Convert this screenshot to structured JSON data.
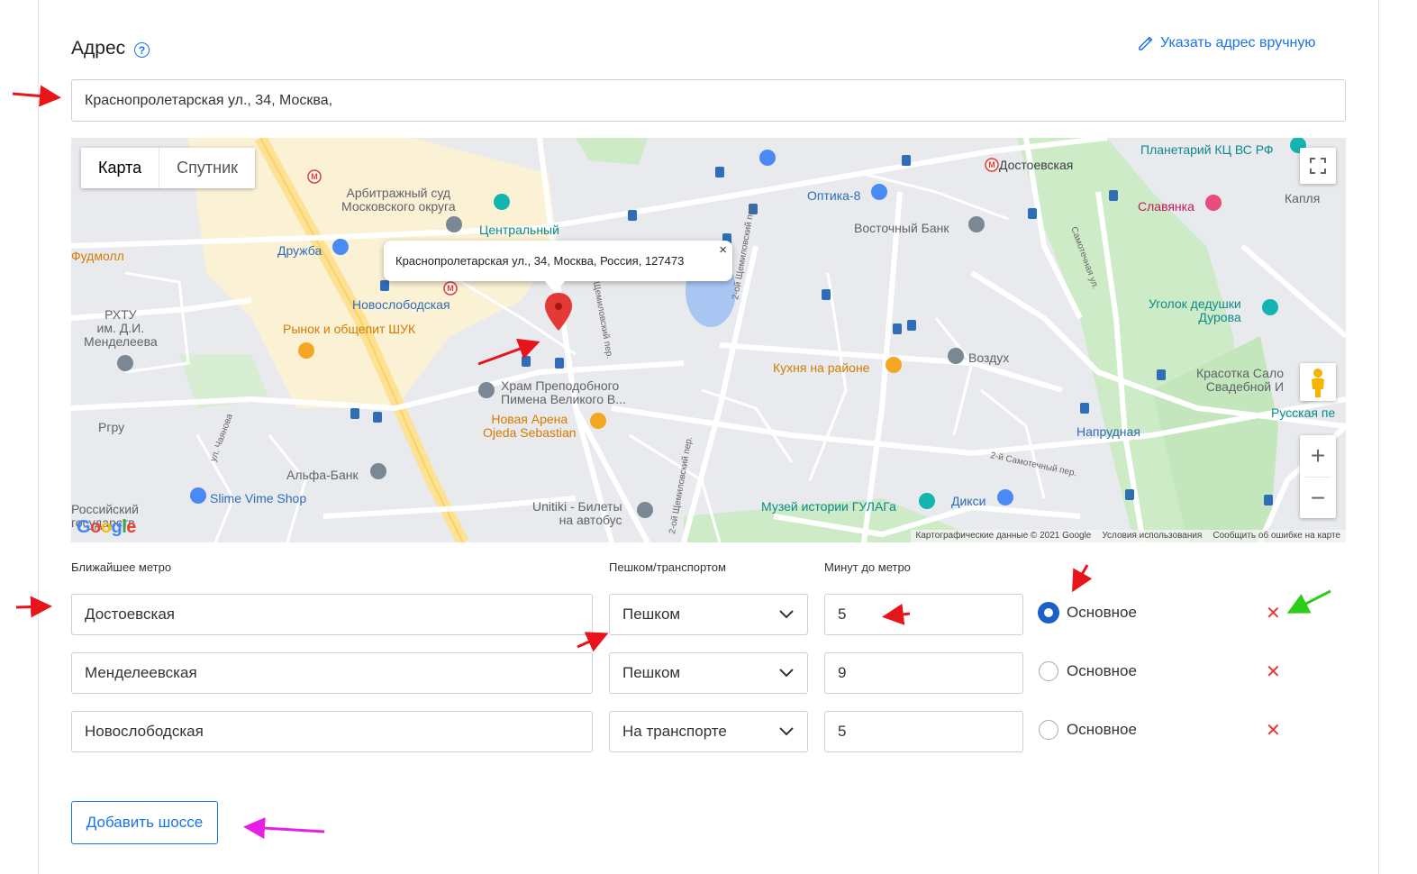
{
  "address": {
    "title": "Адрес",
    "help_icon": "?",
    "manual_link": "Указать адрес вручную",
    "value": "Краснопролетарская ул., 34, Москва,"
  },
  "map": {
    "tabs": [
      "Карта",
      "Спутник"
    ],
    "popup_text": "Краснопролетарская ул., 34, Москва, Россия, 127473",
    "popup_close": "×",
    "zoom_in": "+",
    "zoom_out": "−",
    "attribution": [
      "Картографические данные © 2021 Google",
      "Условия использования",
      "Сообщить об ошибке на карте"
    ],
    "logo": "Google",
    "labels": [
      {
        "text": "Достоевская",
        "style": "dark"
      },
      {
        "text": "Планетарий КЦ ВС РФ",
        "style": "teal"
      },
      {
        "text": "Арбитражный суд\nМосковского округа",
        "style": "gray"
      },
      {
        "text": "Оптика-8",
        "style": "blue"
      },
      {
        "text": "Славянка",
        "style": "pink"
      },
      {
        "text": "Капля",
        "style": "gray"
      },
      {
        "text": "Центральный",
        "style": "teal"
      },
      {
        "text": "Восточный Банк",
        "style": "gray"
      },
      {
        "text": "Фудмолл",
        "style": "orange"
      },
      {
        "text": "Дружба",
        "style": "blue"
      },
      {
        "text": "Новослободская",
        "style": "blue"
      },
      {
        "text": "Уголок дедушки\nДурова",
        "style": "teal"
      },
      {
        "text": "РХТУ\nим. Д.И.\nМенделеева",
        "style": "gray"
      },
      {
        "text": "Рынок и общепит ШУК",
        "style": "orange"
      },
      {
        "text": "Кухня на районе",
        "style": "orange"
      },
      {
        "text": "Воздух",
        "style": "gray"
      },
      {
        "text": "Красотка Сало\nСвадебной И",
        "style": "gray"
      },
      {
        "text": "Храм Преподобного\nПимена Великого В...",
        "style": "gray"
      },
      {
        "text": "Новая Арена\nOjeda Sebastian",
        "style": "orange"
      },
      {
        "text": "Русская пе",
        "style": "teal"
      },
      {
        "text": "Напрудная",
        "style": "blue"
      },
      {
        "text": "Ргру",
        "style": "gray"
      },
      {
        "text": "Альфа-Банк",
        "style": "gray"
      },
      {
        "text": "Slime Vime Shop",
        "style": "blue"
      },
      {
        "text": "Музей истории ГУЛАГа",
        "style": "teal"
      },
      {
        "text": "Дикси",
        "style": "blue"
      },
      {
        "text": "Unitiki - Билеты\nна автобус",
        "style": "gray"
      },
      {
        "text": "Российский\nгосударств",
        "style": "gray"
      }
    ]
  },
  "metro": {
    "headers": {
      "station": "Ближайшее метро",
      "mode": "Пешком/транспортом",
      "minutes": "Минут до метро"
    },
    "rows": [
      {
        "station": "Достоевская",
        "mode": "Пешком",
        "minutes": "5",
        "primary_label": "Основное",
        "primary": true,
        "delete": "✕"
      },
      {
        "station": "Менделеевская",
        "mode": "Пешком",
        "minutes": "9",
        "primary_label": "Основное",
        "primary": false,
        "delete": "✕"
      },
      {
        "station": "Новослободская",
        "mode": "На транспорте",
        "minutes": "5",
        "primary_label": "Основное",
        "primary": false,
        "delete": "✕"
      }
    ]
  },
  "add_highway": "Добавить шоссе",
  "colors": {
    "accent": "#1a73e8",
    "delete": "#e53935",
    "radio_checked": "#1c5fc9"
  }
}
